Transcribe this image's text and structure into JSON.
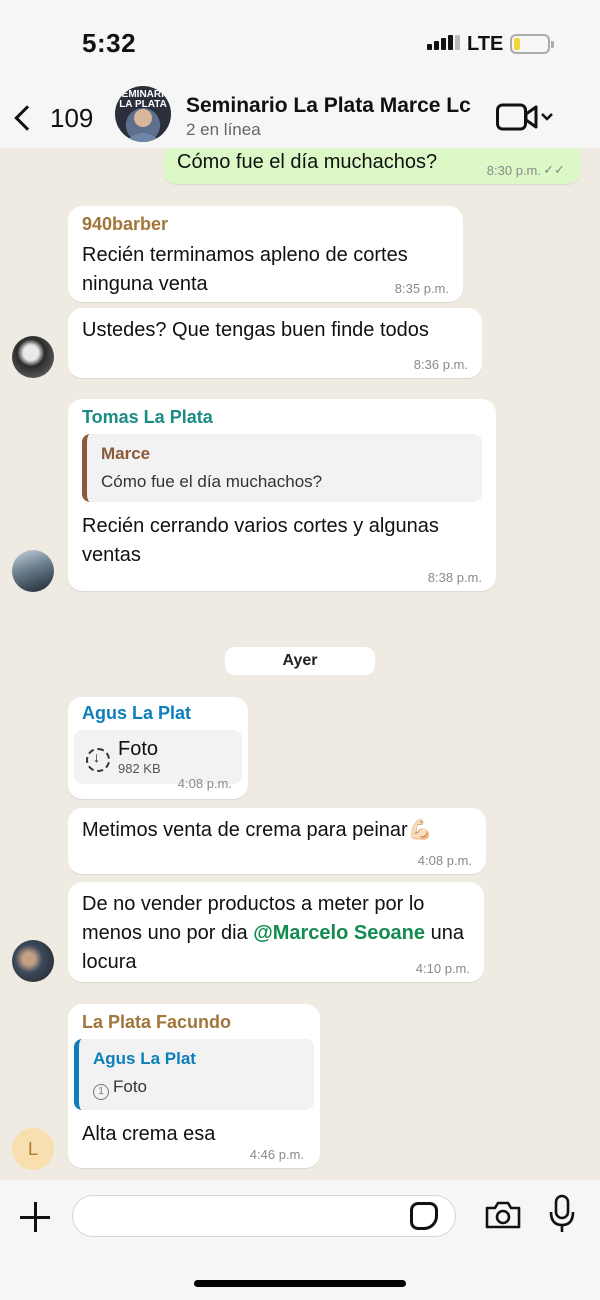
{
  "status_bar": {
    "time": "5:32",
    "network": "LTE"
  },
  "header": {
    "back_count": "109",
    "group_name": "Seminario La Plata Marce Lc",
    "subtitle": "2 en línea",
    "avatar_text": "SEMINARIO LA PLATA",
    "icons": [
      "back-chevron-icon",
      "video-call-icon",
      "chevron-down-icon"
    ]
  },
  "messages": {
    "m1": {
      "text": "Cómo fue el día muchachos?",
      "time": "8:30 p.m."
    },
    "m2": {
      "sender": "940barber",
      "sender_color": "#a0763a",
      "text": "Recién terminamos apleno de cortes ninguna venta",
      "time": "8:35 p.m."
    },
    "m3": {
      "text": "Ustedes? Que tengas buen finde todos",
      "time": "8:36 p.m."
    },
    "m4": {
      "sender": "Tomas La Plata",
      "sender_color": "#1c8b84",
      "quote_author": "Marce",
      "quote_author_color": "#8a5a3a",
      "quote_text": "Cómo fue el día muchachos?",
      "text": "Recién cerrando varios cortes y algunas ventas",
      "time": "8:38 p.m."
    },
    "date_divider": "Ayer",
    "m5": {
      "sender": "Agus La Plat",
      "sender_color": "#0d7fba",
      "file_name": "Foto",
      "file_size": "982 KB",
      "time": "4:08 p.m."
    },
    "m6": {
      "text": "Metimos venta de crema para peinar💪🏻",
      "time": "4:08 p.m."
    },
    "m7": {
      "text_before": "De no vender productos a meter por lo menos uno por dia ",
      "mention": "@Marcelo Seoane",
      "text_after": " una locura",
      "time": "4:10 p.m."
    },
    "m8": {
      "sender": "La Plata Facundo",
      "sender_color": "#a0763a",
      "quote_author": "Agus La Plat",
      "quote_author_color": "#0d7fba",
      "quote_text": "Foto",
      "text": "Alta crema esa",
      "time": "4:46 p.m.",
      "avatar_letter": "L"
    }
  },
  "composer": {
    "placeholder": ""
  },
  "colors": {
    "outgoing_bubble": "#dbf8c6",
    "incoming_bubble": "#ffffff",
    "chat_bg": "#efeae2",
    "mention": "#128c4e"
  }
}
